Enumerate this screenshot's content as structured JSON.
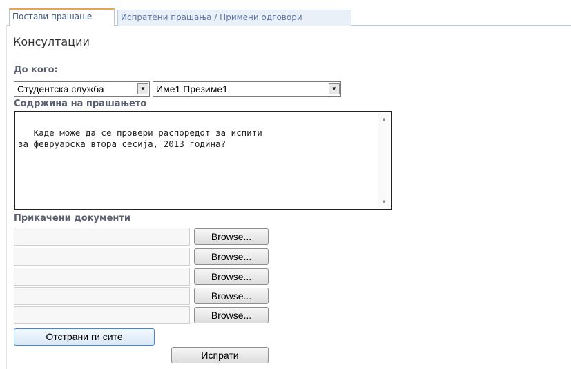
{
  "tabs": [
    {
      "label": "Постави прашање"
    },
    {
      "label": "Испратени прашања / Примени одговори"
    }
  ],
  "page_title": "Консултации",
  "recipient": {
    "label": "До кого:",
    "department_value": "Студентска служба",
    "person_value": "Име1 Презиме1"
  },
  "question": {
    "label": "Содржина на прашањето",
    "text": " Каде може да се провери распоредот за испити\nза февруарска втора сесија, 2013 година?"
  },
  "attachments": {
    "label": "Прикачени документи",
    "browse_label": "Browse..."
  },
  "actions": {
    "remove_all_label": "Отстрани ги сите",
    "send_label": "Испрати"
  }
}
